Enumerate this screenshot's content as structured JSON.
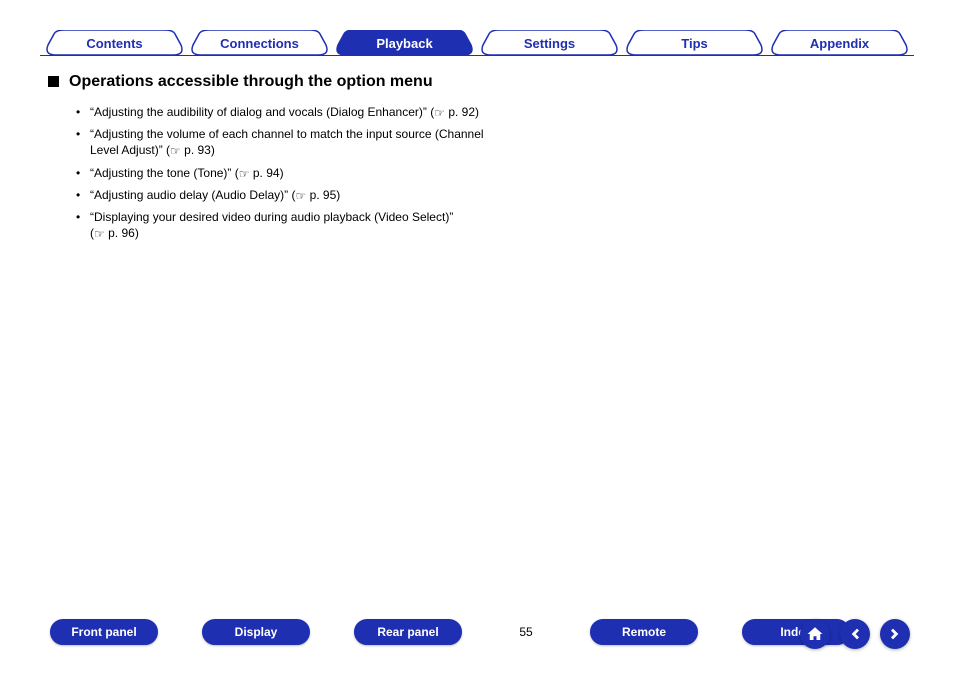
{
  "tabs": [
    {
      "label": "Contents",
      "active": false
    },
    {
      "label": "Connections",
      "active": false
    },
    {
      "label": "Playback",
      "active": true
    },
    {
      "label": "Settings",
      "active": false
    },
    {
      "label": "Tips",
      "active": false
    },
    {
      "label": "Appendix",
      "active": false
    }
  ],
  "heading": "Operations accessible through the option menu",
  "bullets": [
    {
      "text": "“Adjusting the audibility of dialog and vocals (Dialog Enhancer)”",
      "page": "p. 92"
    },
    {
      "text": "“Adjusting the volume of each channel to match the input source (Channel Level Adjust)”",
      "page": "p. 93"
    },
    {
      "text": "“Adjusting the tone (Tone)”",
      "page": "p. 94"
    },
    {
      "text": "“Adjusting audio delay (Audio Delay)”",
      "page": "p. 95"
    },
    {
      "text": "“Displaying your desired video during audio playback (Video Select)”",
      "page": "p. 96"
    }
  ],
  "bottom_buttons_left": [
    "Front panel",
    "Display",
    "Rear panel"
  ],
  "page_number": "55",
  "bottom_buttons_right": [
    "Remote",
    "Index"
  ],
  "nav_icons": [
    "home-icon",
    "prev-icon",
    "next-icon"
  ],
  "colors": {
    "brand": "#1f2fb2"
  }
}
